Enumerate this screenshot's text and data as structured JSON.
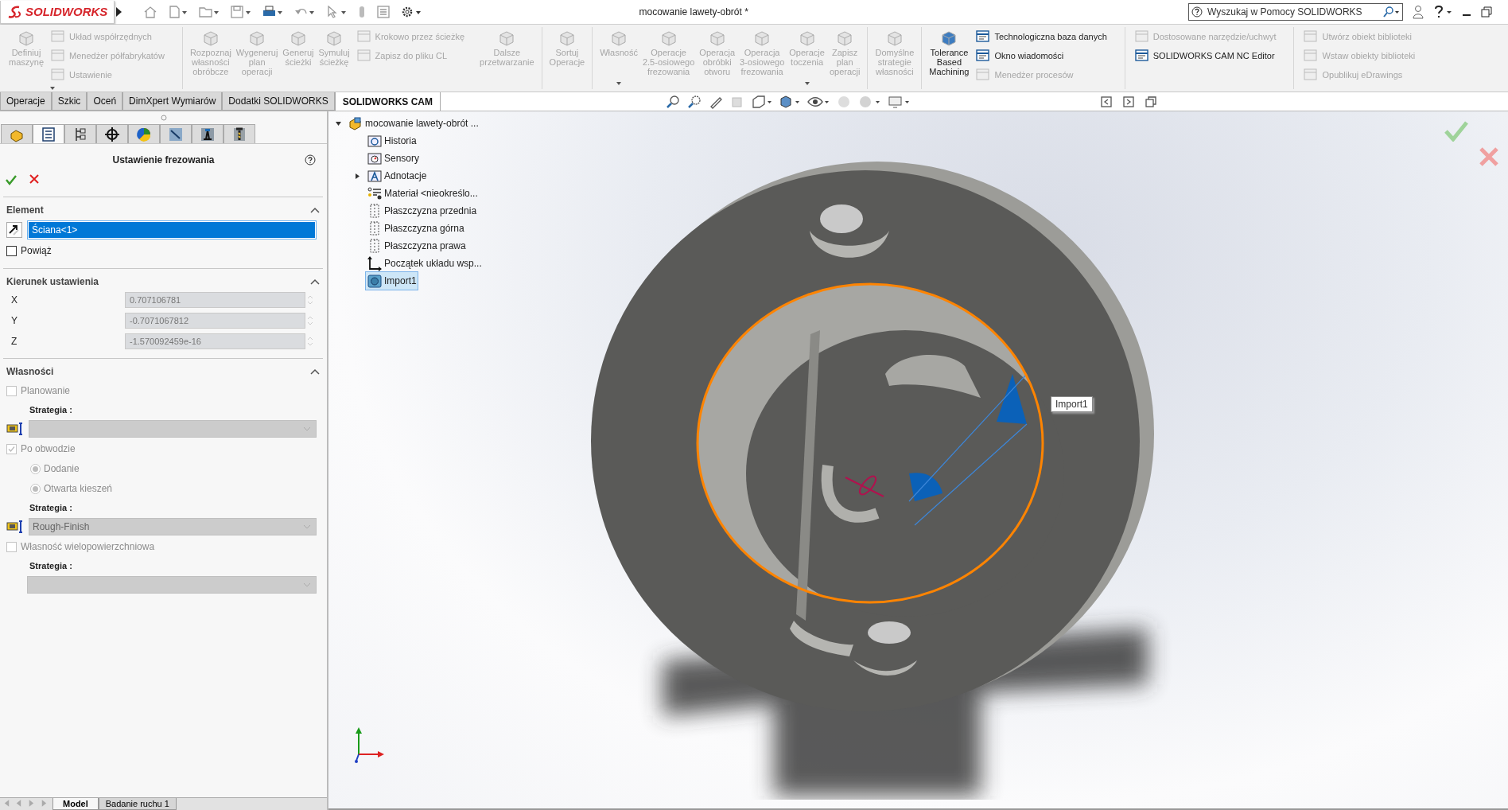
{
  "title_bar": {
    "logo": "SOLIDWORKS",
    "document_title": "mocowanie lawety-obrót *",
    "search": {
      "placeholder": "Wyszukaj w Pomocy SOLIDWORKS"
    }
  },
  "ribbon": {
    "groups": [
      [
        {
          "kind": "large",
          "label": "Definiuj maszynę",
          "disabled": true
        },
        {
          "kind": "stack",
          "menu": true,
          "items": [
            {
              "label": "Układ współrzędnych",
              "disabled": true
            },
            {
              "label": "Menedżer półfabrykatów",
              "disabled": true
            },
            {
              "label": "Ustawienie",
              "disabled": true
            }
          ]
        }
      ],
      [
        {
          "kind": "large",
          "label": "Rozpoznaj własności obróbcze",
          "disabled": true
        },
        {
          "kind": "large",
          "label": "Wygeneruj plan operacji",
          "disabled": true
        },
        {
          "kind": "large",
          "label": "Generuj ścieżki",
          "disabled": true
        },
        {
          "kind": "large",
          "label": "Symuluj ścieżkę",
          "disabled": true
        },
        {
          "kind": "stack",
          "items": [
            {
              "label": "Krokowo przez ścieżkę",
              "disabled": true
            },
            {
              "label": "Zapisz do pliku CL",
              "disabled": true
            }
          ]
        },
        {
          "kind": "large",
          "label": "Dalsze przetwarzanie",
          "disabled": true
        }
      ],
      [
        {
          "kind": "large",
          "label": "Sortuj Operacje",
          "disabled": true
        }
      ],
      [
        {
          "kind": "large",
          "label": "Własność",
          "disabled": true,
          "menu": true
        },
        {
          "kind": "large",
          "label": "Operacje 2.5-osiowego frezowania",
          "disabled": true
        },
        {
          "kind": "large",
          "label": "Operacja obróbki otworu",
          "disabled": true
        },
        {
          "kind": "large",
          "label": "Operacja 3-osiowego frezowania",
          "disabled": true
        },
        {
          "kind": "large",
          "label": "Operacje toczenia",
          "disabled": true,
          "menu": true
        },
        {
          "kind": "large",
          "label": "Zapisz plan operacji",
          "disabled": true
        }
      ],
      [
        {
          "kind": "large",
          "label": "Domyślne strategie własności",
          "disabled": true
        }
      ],
      [
        {
          "kind": "large",
          "label": "Tolerance Based Machining",
          "disabled": false
        },
        {
          "kind": "stack",
          "items": [
            {
              "label": "Technologiczna baza danych",
              "disabled": false
            },
            {
              "label": "Okno wiadomości",
              "disabled": false
            },
            {
              "label": "Menedżer procesów",
              "disabled": true
            }
          ]
        }
      ],
      [
        {
          "kind": "stack",
          "items": [
            {
              "label": "Dostosowane narzędzie/uchwyt",
              "disabled": true
            },
            {
              "label": "SOLIDWORKS CAM NC Editor",
              "disabled": false
            }
          ]
        }
      ],
      [
        {
          "kind": "stack",
          "items": [
            {
              "label": "Utwórz obiekt biblioteki",
              "disabled": true
            },
            {
              "label": "Wstaw obiekty biblioteki",
              "disabled": true
            },
            {
              "label": "Opublikuj eDrawings",
              "disabled": true
            }
          ]
        }
      ]
    ]
  },
  "command_tabs": [
    {
      "label": "Operacje",
      "selected": false
    },
    {
      "label": "Szkic",
      "selected": false
    },
    {
      "label": "Oceń",
      "selected": false
    },
    {
      "label": "DimXpert Wymiarów",
      "selected": false
    },
    {
      "label": "Dodatki SOLIDWORKS",
      "selected": false
    },
    {
      "label": "SOLIDWORKS CAM",
      "selected": true
    }
  ],
  "property_manager": {
    "tabs": [
      {
        "selected": false
      },
      {
        "selected": true
      },
      {
        "selected": false
      },
      {
        "selected": false
      },
      {
        "selected": false
      },
      {
        "selected": false
      },
      {
        "selected": false
      },
      {
        "selected": false
      }
    ],
    "title": "Ustawienie frezowania",
    "sections": [
      {
        "title": "Element",
        "expanded": true,
        "items": [
          {
            "kind": "selection",
            "value": "Ściana<1>",
            "selected": true
          },
          {
            "kind": "checkbox",
            "label": "Powiąż",
            "checked": false,
            "disabled": false
          }
        ]
      },
      {
        "title": "Kierunek ustawienia",
        "expanded": true,
        "items": [
          {
            "kind": "coord",
            "label": "X",
            "value": "0.707106781"
          },
          {
            "kind": "coord",
            "label": "Y",
            "value": "-0.7071067812"
          },
          {
            "kind": "coord",
            "label": "Z",
            "value": "-1.570092459e-16"
          }
        ]
      },
      {
        "title": "Własności",
        "expanded": true,
        "items": [
          {
            "kind": "checkbox",
            "label": "Planowanie",
            "checked": false,
            "disabled": true
          },
          {
            "kind": "label",
            "label": "Strategia :"
          },
          {
            "kind": "dropdown",
            "icon": true
          },
          {
            "kind": "checkbox",
            "label": "Po obwodzie",
            "checked": true,
            "disabled": true
          },
          {
            "kind": "radio",
            "label": "Dodanie",
            "selected": true
          },
          {
            "kind": "radio",
            "label": "Otwarta kieszeń",
            "selected": true
          },
          {
            "kind": "label",
            "label": "Strategia :"
          },
          {
            "kind": "dropdown",
            "icon": true,
            "value": "Rough-Finish"
          },
          {
            "kind": "checkbox",
            "label": "Własność wielopowierzchniowa",
            "checked": false,
            "disabled": true
          },
          {
            "kind": "label",
            "label": "Strategia :"
          },
          {
            "kind": "dropdown",
            "icon": false
          }
        ]
      }
    ]
  },
  "feature_tree": {
    "label": "mocowanie lawety-obrót ...",
    "expanded": true,
    "children": [
      {
        "kind": "history",
        "label": "Historia",
        "selected": false
      },
      {
        "kind": "sensors",
        "label": "Sensory",
        "selected": false
      },
      {
        "kind": "annotations",
        "label": "Adnotacje",
        "selected": false,
        "expanded": false
      },
      {
        "kind": "material",
        "label": "Materiał <nieokreślo...",
        "selected": false
      },
      {
        "kind": "plane",
        "label": "Płaszczyzna przednia",
        "selected": false
      },
      {
        "kind": "plane",
        "label": "Płaszczyzna górna",
        "selected": false
      },
      {
        "kind": "plane",
        "label": "Płaszczyzna prawa",
        "selected": false
      },
      {
        "kind": "origin",
        "label": "Początek układu wsp...",
        "selected": false
      },
      {
        "kind": "body",
        "label": "Import1",
        "selected": true
      }
    ]
  },
  "viewport": {
    "tooltip": "Import1"
  },
  "bottom_tabs": [
    {
      "label": "Model",
      "selected": true
    },
    {
      "label": "Badanie ruchu 1",
      "selected": false
    }
  ]
}
